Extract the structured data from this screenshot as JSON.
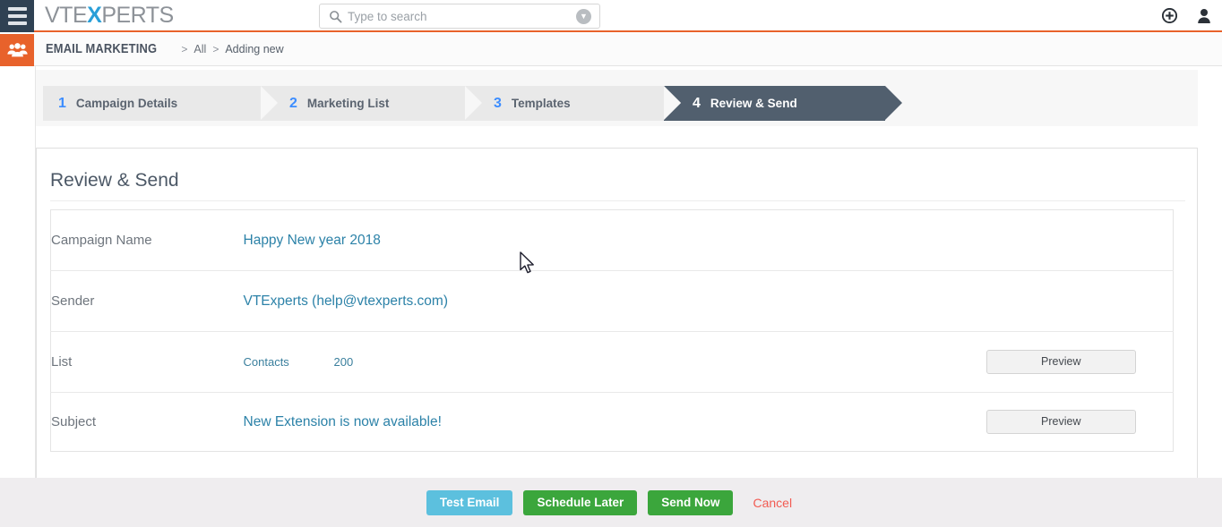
{
  "topbar": {
    "menu_icon": "hamburger-icon",
    "brand_prefix": "VTE",
    "brand_x": "X",
    "brand_suffix": "PERTS",
    "search": {
      "placeholder": "Type to search",
      "value": "",
      "icon": "search-icon",
      "dropdown_icon": "chevron-down-circle-icon"
    },
    "quick_create_icon": "plus-circle-icon",
    "user_icon": "user-icon"
  },
  "breadcrumb": {
    "module_icon": "users-group-icon",
    "module": "EMAIL MARKETING",
    "sep": ">",
    "parent": "All",
    "current": "Adding new"
  },
  "wizard": {
    "steps": [
      {
        "num": "1",
        "label": "Campaign Details",
        "active": false
      },
      {
        "num": "2",
        "label": "Marketing List",
        "active": false
      },
      {
        "num": "3",
        "label": "Templates",
        "active": false
      },
      {
        "num": "4",
        "label": "Review & Send",
        "active": true
      }
    ]
  },
  "panel": {
    "title": "Review & Send",
    "rows": [
      {
        "label": "Campaign Name",
        "value": "Happy New year 2018",
        "action": ""
      },
      {
        "label": "Sender",
        "value": "VTExperts (help@vtexperts.com)",
        "action": ""
      },
      {
        "label": "List",
        "list_name": "Contacts",
        "list_count": "200",
        "action": "Preview"
      },
      {
        "label": "Subject",
        "value": "New Extension is now available!",
        "action": "Preview"
      }
    ]
  },
  "footer": {
    "test_email": "Test Email",
    "schedule_later": "Schedule Later",
    "send_now": "Send Now",
    "cancel": "Cancel"
  },
  "colors": {
    "accent_orange": "#E8622B",
    "navy": "#2F4153",
    "step_active": "#515F6E",
    "step_number": "#3C8DFF",
    "link_teal": "#2C82A8",
    "btn_info": "#5CC0DE",
    "btn_success": "#3BA63C",
    "btn_cancel": "#F25B52"
  }
}
